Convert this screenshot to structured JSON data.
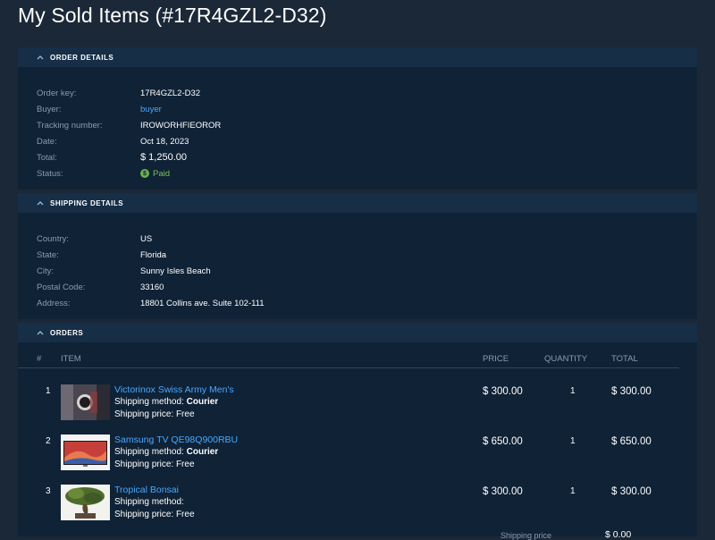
{
  "page": {
    "title": "My Sold Items (#17R4GZL2-D32)"
  },
  "order_details": {
    "header": "ORDER DETAILS",
    "rows": [
      {
        "label": "Order key:",
        "value": "17R4GZL2-D32"
      },
      {
        "label": "Buyer:",
        "value": "buyer"
      },
      {
        "label": "Tracking number:",
        "value": "IROWORHFIEOROR"
      },
      {
        "label": "Date:",
        "value": "Oct 18, 2023"
      },
      {
        "label": "Total:",
        "value": "$ 1,250.00"
      },
      {
        "label": "Status:",
        "value": "Paid"
      }
    ],
    "status_icon": "dollar-icon",
    "status_icon_glyph": "$"
  },
  "shipping_details": {
    "header": "SHIPPING DETAILS",
    "rows": [
      {
        "label": "Country:",
        "value": "US"
      },
      {
        "label": "State:",
        "value": "Florida"
      },
      {
        "label": "City:",
        "value": "Sunny Isles Beach"
      },
      {
        "label": "Postal Code:",
        "value": "33160"
      },
      {
        "label": "Address:",
        "value": "18801 Collins ave. Suite 102-111"
      }
    ]
  },
  "orders": {
    "header": "ORDERS",
    "columns": {
      "num": "#",
      "item": "ITEM",
      "price": "PRICE",
      "quantity": "QUANTITY",
      "total": "TOTAL"
    },
    "shipping_method_label": "Shipping method:",
    "shipping_price_label": "Shipping price:",
    "items": [
      {
        "num": "1",
        "name": "Victorinox Swiss Army Men's",
        "shipping_method": "Courier",
        "shipping_price": "Free",
        "price": "$ 300.00",
        "quantity": "1",
        "total": "$ 300.00"
      },
      {
        "num": "2",
        "name": "Samsung TV QE98Q900RBU",
        "shipping_method": "Courier",
        "shipping_price": "Free",
        "price": "$ 650.00",
        "quantity": "1",
        "total": "$ 650.00"
      },
      {
        "num": "3",
        "name": "Tropical Bonsai",
        "shipping_method": "",
        "shipping_price": "Free",
        "price": "$ 300.00",
        "quantity": "1",
        "total": "$ 300.00"
      }
    ],
    "summary": {
      "label": "Shipping price",
      "value": "$ 0.00"
    }
  },
  "colors": {
    "background": "#1b2838",
    "panel": "#0f2236",
    "panel_header": "#162e46",
    "link": "#4aa8ff",
    "label": "#8a9bb0",
    "paid": "#7ec35c"
  }
}
